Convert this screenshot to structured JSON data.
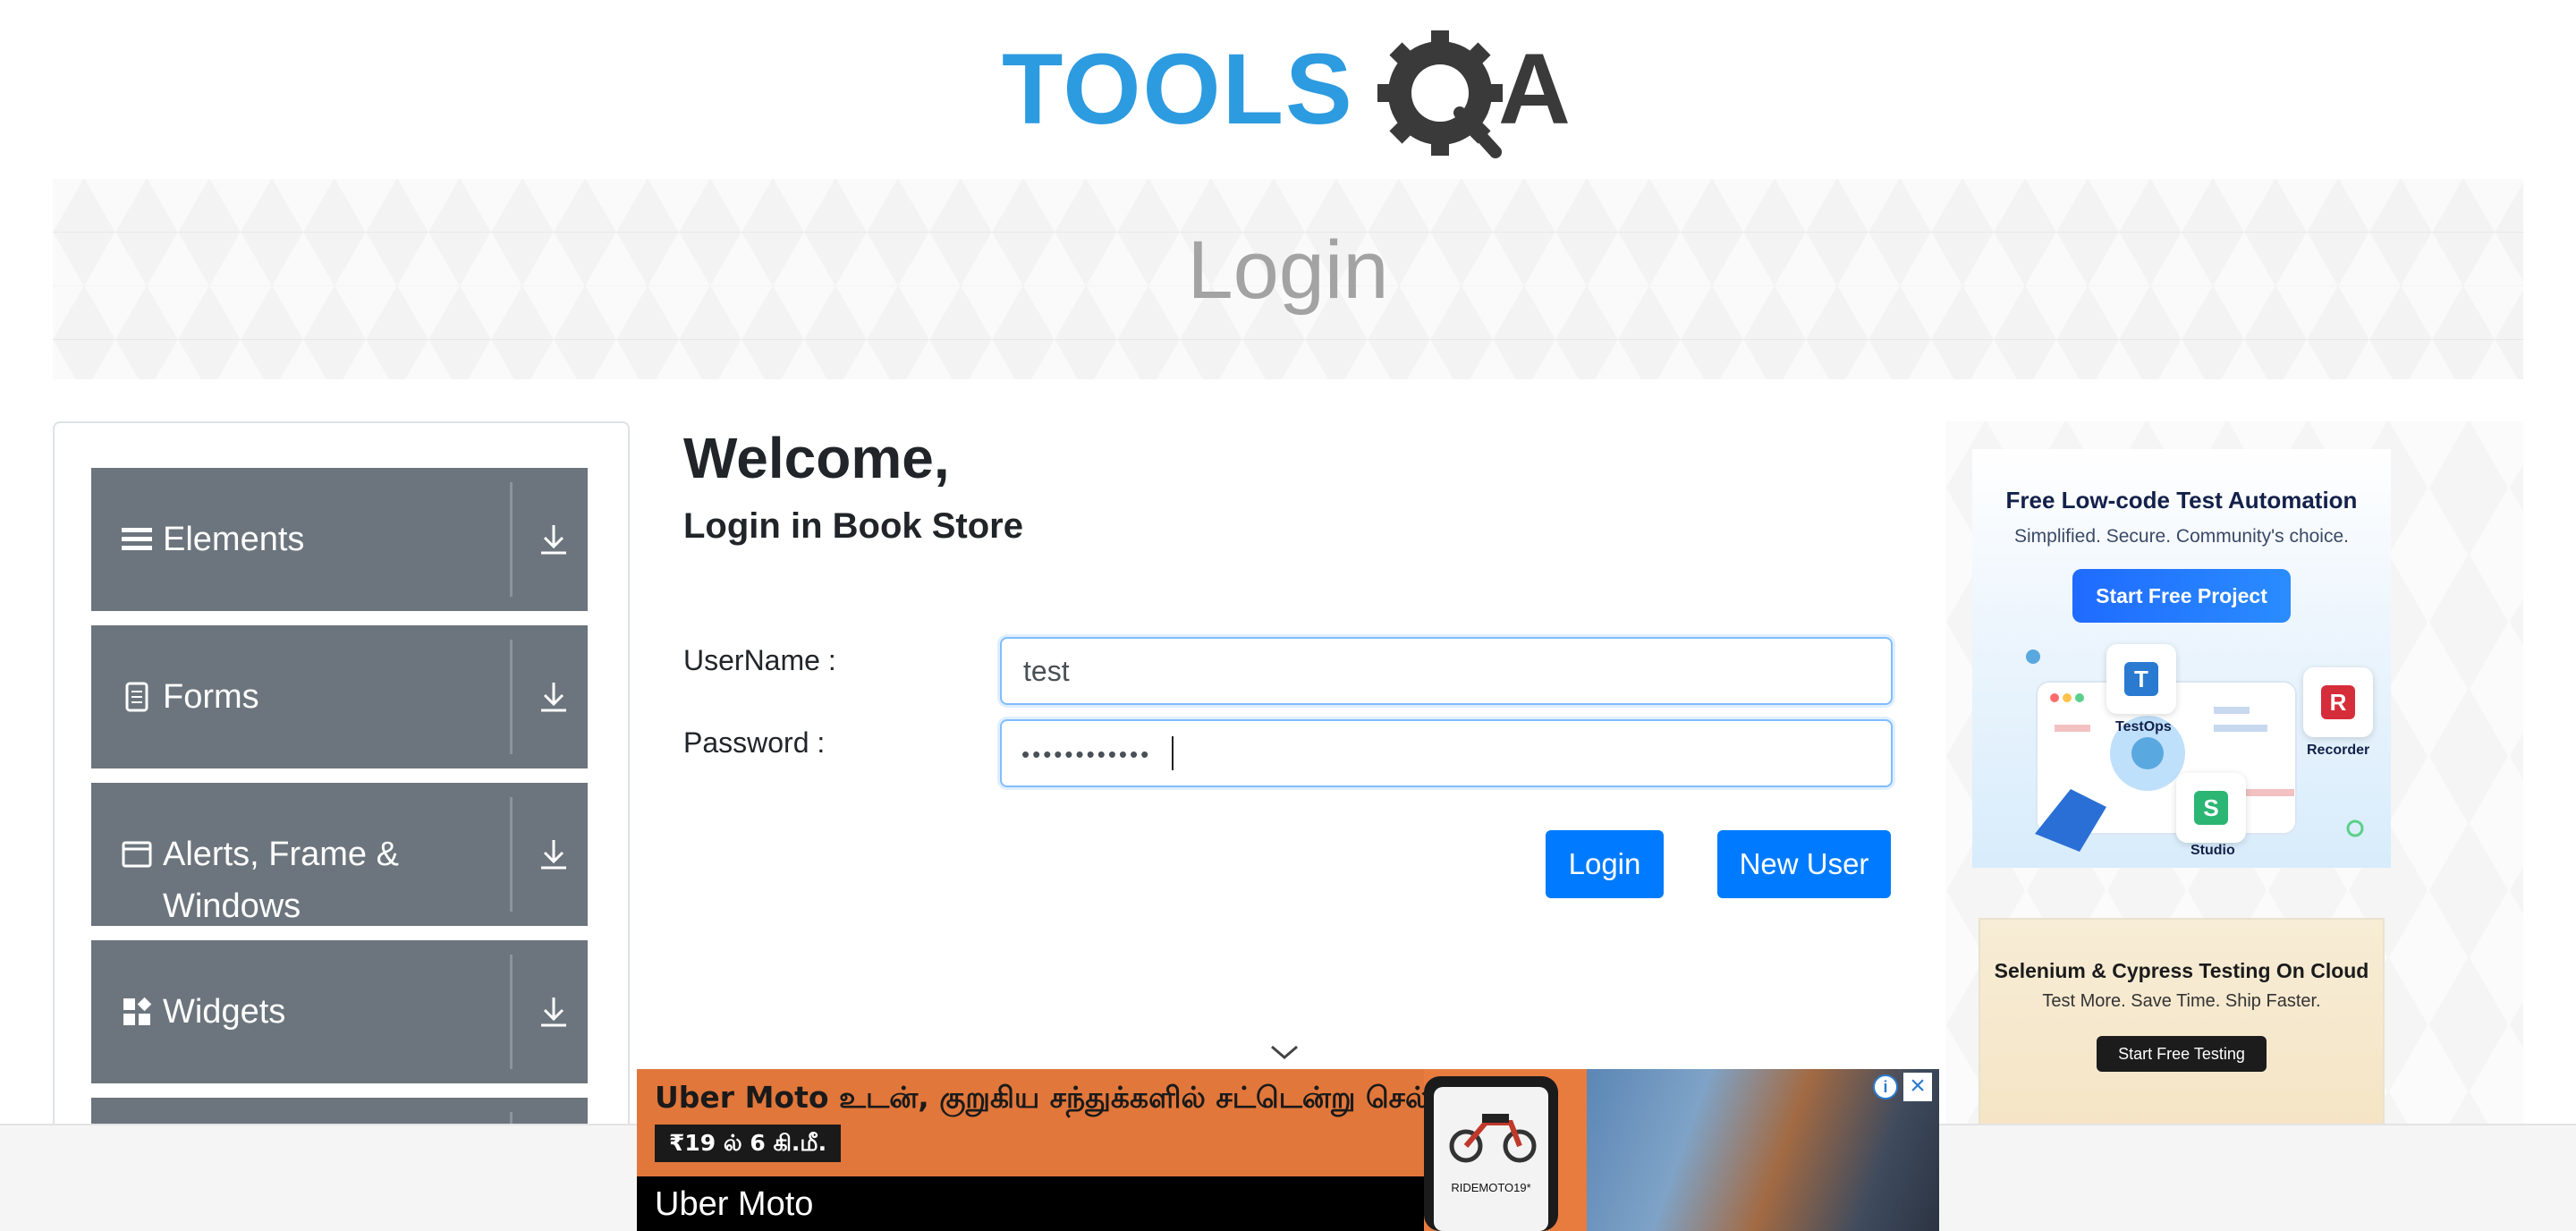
{
  "header": {
    "logo_text": "TOOLSQA"
  },
  "banner": {
    "title": "Login"
  },
  "sidebar": {
    "groups": [
      {
        "label": "Elements",
        "icon": "hamburger-icon"
      },
      {
        "label": "Forms",
        "icon": "document-icon"
      },
      {
        "label": "Alerts, Frame & Windows",
        "icon": "window-icon"
      },
      {
        "label": "Widgets",
        "icon": "widgets-icon"
      }
    ]
  },
  "main": {
    "welcome": "Welcome,",
    "subheading": "Login in Book Store",
    "username_label": "UserName :",
    "username_value": "test",
    "password_label": "Password :",
    "password_masked": "••••••••••••",
    "login_button": "Login",
    "new_user_button": "New User"
  },
  "ads": {
    "right_ad1": {
      "title": "Free Low-code Test Automation",
      "subtitle": "Simplified. Secure. Community's choice.",
      "cta": "Start Free Project",
      "products": [
        "TestOps",
        "Recorder",
        "Studio"
      ],
      "accent": "#1f6bff"
    },
    "right_ad2": {
      "title": "Selenium & Cypress Testing On Cloud",
      "subtitle": "Test More. Save Time. Ship Faster.",
      "cta": "Start Free Testing"
    },
    "bottom_ad": {
      "headline": "Uber Moto உடன், குறுகிய சந்துக்களில் சட்டென்று செல்லுங்கள்.",
      "price": "₹19 ல் 6 கி.மீ.",
      "brand": "Uber Moto",
      "promo": "RIDEMOTO19*",
      "info_icon": "info-icon",
      "close_icon": "close-icon"
    }
  },
  "colors": {
    "primary": "#007bff",
    "sidebar_bg": "#6c757d",
    "logo_blue": "#2d9be0",
    "logo_gray": "#3a3a3a"
  }
}
